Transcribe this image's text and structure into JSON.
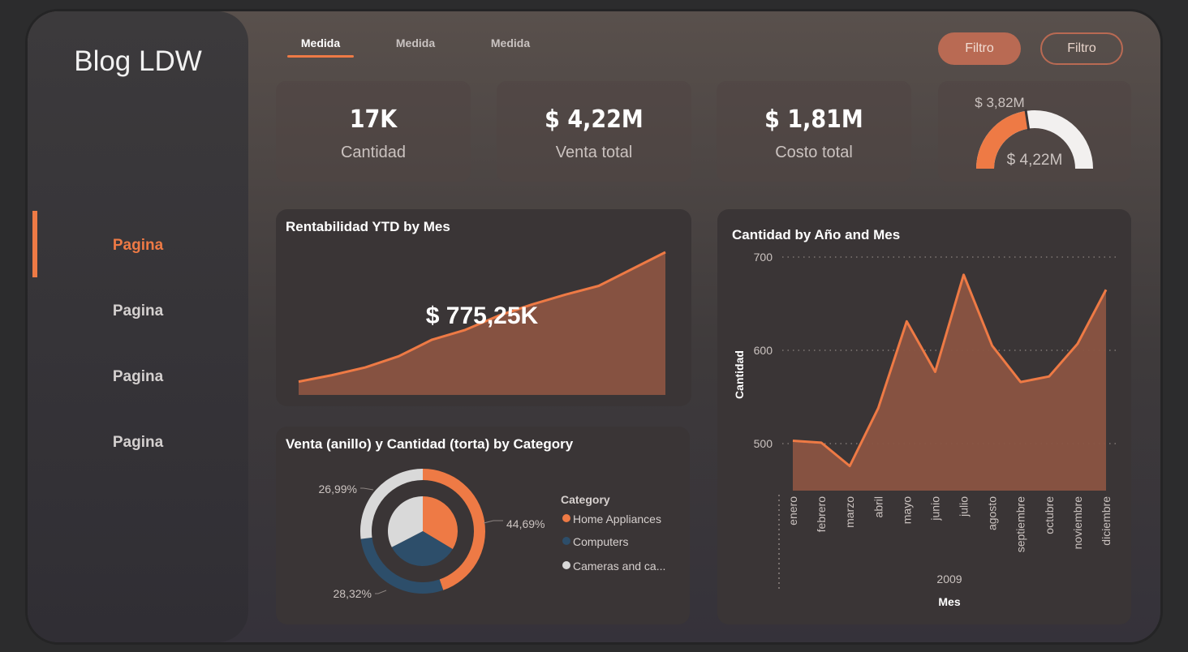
{
  "sidebar": {
    "brand": "Blog LDW",
    "items": [
      {
        "label": "Pagina",
        "active": true
      },
      {
        "label": "Pagina",
        "active": false
      },
      {
        "label": "Pagina",
        "active": false
      },
      {
        "label": "Pagina",
        "active": false
      }
    ]
  },
  "tabs": [
    {
      "label": "Medida",
      "active": true
    },
    {
      "label": "Medida",
      "active": false
    },
    {
      "label": "Medida",
      "active": false
    }
  ],
  "buttons": {
    "filter_filled": "Filtro",
    "filter_outline": "Filtro"
  },
  "kpis": [
    {
      "value": "17K",
      "label": "Cantidad"
    },
    {
      "value": "$ 4,22M",
      "label": "Venta total"
    },
    {
      "value": "$ 1,81M",
      "label": "Costo total"
    }
  ],
  "gauge": {
    "target_label": "$ 3,82M",
    "value_label": "$ 4,22M",
    "target_fraction": 0.452
  },
  "colors": {
    "accent": "#ee7a45",
    "area_fill": "#8a5442",
    "navy": "#2d4e6a",
    "light": "#d9d9d9"
  },
  "chart_data": [
    {
      "type": "area",
      "title": "Rentabilidad YTD by Mes",
      "callout": "$ 775,25K",
      "values": [
        20,
        45,
        75,
        118,
        182,
        220,
        275,
        318,
        356,
        390,
        455,
        520
      ]
    },
    {
      "type": "pie",
      "title": "Venta (anillo) y Cantidad (torta) by Category",
      "legend_title": "Category",
      "categories": [
        "Home Appliances",
        "Computers",
        "Cameras and ca..."
      ],
      "ring_values": [
        44.69,
        28.32,
        26.99
      ],
      "ring_labels": [
        "44,69%",
        "28,32%",
        "26,99%"
      ],
      "pie_values": [
        33.6,
        33.8,
        32.6
      ]
    },
    {
      "type": "area",
      "title": "Cantidad by Año and Mes",
      "xlabel": "Mes",
      "ylabel": "Cantidad",
      "year": "2009",
      "categories": [
        "enero",
        "febrero",
        "marzo",
        "abril",
        "mayo",
        "junio",
        "julio",
        "agosto",
        "septiembre",
        "octubre",
        "noviembre",
        "diciembre"
      ],
      "values": [
        503,
        501,
        476,
        538,
        631,
        577,
        681,
        605,
        566,
        572,
        607,
        665
      ],
      "ylim": [
        450,
        700
      ],
      "yticks": [
        500,
        600,
        700
      ]
    }
  ]
}
